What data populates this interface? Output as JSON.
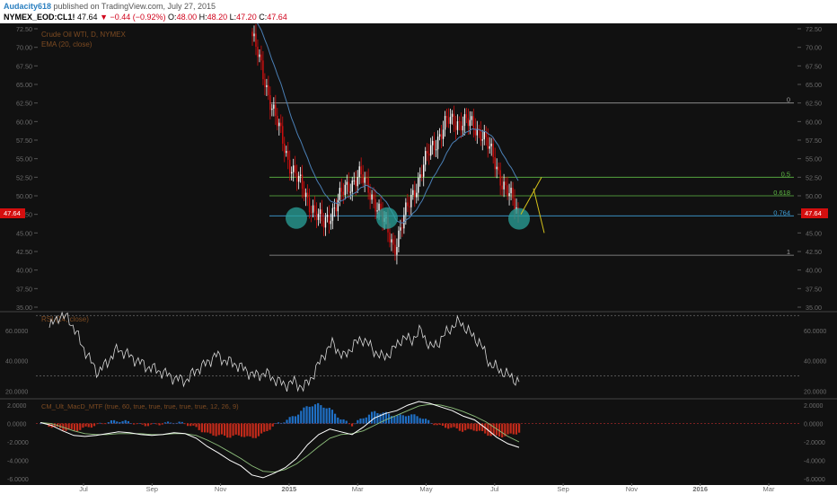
{
  "header": {
    "author": "Audacity618",
    "published_text": "published on TradingView.com, July 27, 2015",
    "symbol": "NYMEX_EOD:CL1!",
    "last": "47.64",
    "change": "▼ −0.44 (−0.92%)",
    "open_label": "O:",
    "open": "48.00",
    "high_label": "H:",
    "high": "48.20",
    "low_label": "L:",
    "low": "47.20",
    "close_label": "C:",
    "close": "47.64"
  },
  "colors": {
    "background": "#111111",
    "up": "#ffffff",
    "down": "#d50f0f",
    "ema": "#4a7fb5",
    "fib_line": "#5fba45",
    "fib_070": "#3f9fd8",
    "circle": "#2aa39b",
    "rsi": "#d8d8d8",
    "macd": "#ffffff",
    "signal": "#8ec07c",
    "hist_pos": "#1f6fc4",
    "hist_neg": "#c22a1a",
    "projection": "#d4c11a"
  },
  "chart_data": [
    {
      "type": "candlestick",
      "title": "Crude Oil WTI, D, NYMEX",
      "indicator": "EMA (20, close)",
      "last_price_label": "47.64",
      "ylim": [
        35.0,
        72.5
      ],
      "yticks": [
        "72.50",
        "70.00",
        "67.50",
        "65.00",
        "62.50",
        "60.00",
        "57.50",
        "55.00",
        "52.50",
        "50.00",
        "47.50",
        "45.00",
        "42.50",
        "40.00",
        "37.50",
        "35.00"
      ],
      "xticks": [
        "Jul",
        "Sep",
        "Nov",
        "2015",
        "Mar",
        "May",
        "Jul",
        "Sep",
        "Nov",
        "2016",
        "Mar"
      ],
      "anchors": [
        {
          "month": "Dec",
          "price": 71.5
        },
        {
          "month": "Dec",
          "price": 63.0
        },
        {
          "month": "Dec",
          "price": 55.0
        },
        {
          "month": "2015",
          "price": 50.0
        },
        {
          "month": "2015",
          "price": 46.0
        },
        {
          "month": "Feb",
          "price": 50.0
        },
        {
          "month": "Feb",
          "price": 53.0
        },
        {
          "month": "Mar",
          "price": 49.0
        },
        {
          "month": "Mar",
          "price": 43.0
        },
        {
          "month": "Apr",
          "price": 50.0
        },
        {
          "month": "Apr",
          "price": 56.0
        },
        {
          "month": "May",
          "price": 60.0
        },
        {
          "month": "Jun",
          "price": 60.0
        },
        {
          "month": "Jul",
          "price": 58.5
        },
        {
          "month": "Jul",
          "price": 52.5
        },
        {
          "month": "Jul",
          "price": 47.64
        }
      ],
      "fibonacci": [
        {
          "label": "0",
          "price": 62.5
        },
        {
          "label": "0.5",
          "price": 52.5
        },
        {
          "label": "0.618",
          "price": 50.0
        },
        {
          "label": "0.764",
          "price": 47.3
        },
        {
          "label": "1",
          "price": 42.0
        }
      ],
      "circles": [
        47.0,
        47.0,
        46.9
      ],
      "projection": [
        {
          "price": 52.5
        },
        {
          "price": 47.5
        },
        {
          "price": 45.0
        }
      ]
    },
    {
      "type": "line",
      "title": "RSI (14, close)",
      "yticks": [
        "60.0000",
        "40.0000",
        "20.0000"
      ],
      "ylim": [
        16,
        72
      ],
      "bands": [
        70,
        30
      ],
      "anchors": [
        62,
        70,
        68,
        55,
        42,
        32,
        40,
        48,
        44,
        40,
        36,
        34,
        31,
        28,
        27,
        34,
        38,
        44,
        40,
        38,
        34,
        30,
        32,
        28,
        24,
        26,
        22,
        31,
        44,
        52,
        42,
        50,
        55,
        48,
        42,
        46,
        55,
        54,
        60,
        48,
        54,
        62,
        66,
        58,
        52,
        38,
        34,
        30,
        26
      ]
    },
    {
      "type": "bar+line",
      "title": "CM_Ult_MacD_MTF (true, 60, true, true, true, true, true, 12, 26, 9)",
      "yticks": [
        "2.0000",
        "0.0000",
        "-2.0000",
        "-4.0000",
        "-6.0000"
      ],
      "ylim": [
        -6.5,
        2.5
      ],
      "macd": [
        0.1,
        -0.2,
        -0.8,
        -1.3,
        -1.4,
        -1.3,
        -1.1,
        -0.9,
        -1.0,
        -1.2,
        -1.3,
        -1.2,
        -1.0,
        -1.1,
        -1.6,
        -2.5,
        -3.2,
        -4.0,
        -4.6,
        -5.6,
        -5.9,
        -5.4,
        -4.8,
        -3.8,
        -2.3,
        -1.2,
        -0.6,
        -0.9,
        -1.2,
        -0.4,
        0.6,
        1.1,
        1.4,
        2.0,
        2.4,
        2.2,
        1.8,
        1.4,
        0.8,
        0.4,
        -0.5,
        -1.5,
        -2.2,
        -2.6
      ],
      "signal": [
        0.1,
        0.0,
        -0.4,
        -0.8,
        -1.1,
        -1.2,
        -1.2,
        -1.1,
        -1.1,
        -1.1,
        -1.2,
        -1.2,
        -1.1,
        -1.1,
        -1.3,
        -1.8,
        -2.4,
        -3.1,
        -3.8,
        -4.6,
        -5.2,
        -5.3,
        -5.0,
        -4.4,
        -3.5,
        -2.5,
        -1.6,
        -1.2,
        -1.1,
        -0.8,
        -0.2,
        0.4,
        0.9,
        1.4,
        1.9,
        2.1,
        2.0,
        1.7,
        1.3,
        0.8,
        0.2,
        -0.6,
        -1.4,
        -2.0
      ]
    }
  ]
}
